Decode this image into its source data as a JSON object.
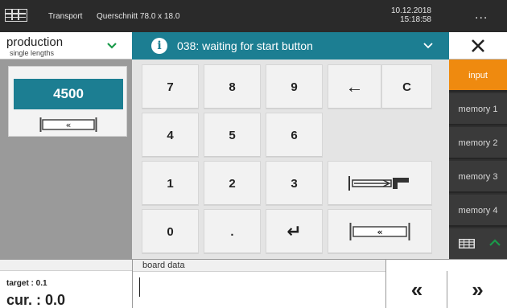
{
  "topbar": {
    "menu_icon": "grid-menu-icon",
    "transport": "Transport",
    "section": "Querschnitt 78.0 x 18.0",
    "date": "10.12.2018",
    "time": "15:18:58",
    "more": "..."
  },
  "mode": {
    "title": "production",
    "subtitle": "single lengths",
    "chevron_color": "#1a9a4a"
  },
  "status": {
    "text": "038: waiting for start button",
    "info_glyph": "i",
    "color": "#1c7e92"
  },
  "value": {
    "display": "4500",
    "button_glyph": "«"
  },
  "keypad": {
    "keys": [
      "7",
      "8",
      "9",
      "←",
      "C",
      "4",
      "5",
      "6",
      "1",
      "2",
      "3",
      "0",
      ".",
      "↵"
    ],
    "transfer_glyph": "«"
  },
  "right_panel": {
    "items": [
      {
        "label": "input",
        "active": true
      },
      {
        "label": "memory 1",
        "active": false
      },
      {
        "label": "memory 2",
        "active": false
      },
      {
        "label": "memory 3",
        "active": false
      },
      {
        "label": "memory 4",
        "active": false
      }
    ],
    "accent": "#ef8a0f"
  },
  "bottom": {
    "target": "target : 0.1",
    "current": "cur. : 0.0",
    "board_label": "board data",
    "board_value": "",
    "prev": "«",
    "next": "»"
  }
}
